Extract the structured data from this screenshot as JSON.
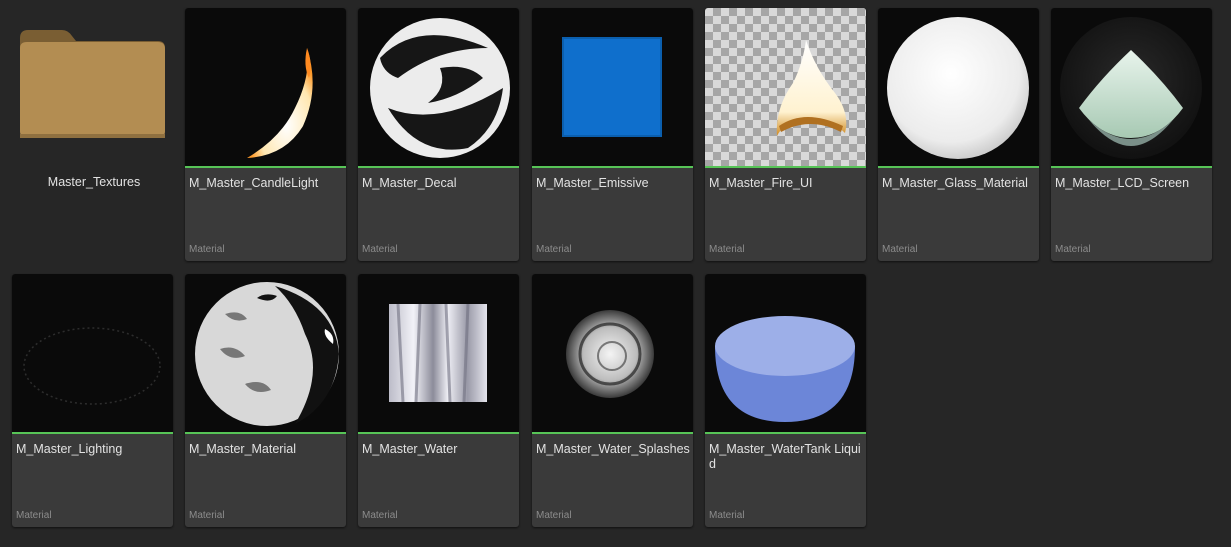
{
  "theme": {
    "background": "#262626",
    "tile_background": "#3a3a3a",
    "material_type_color": "#57c457"
  },
  "folder": {
    "name": "Master_Textures",
    "icon": "folder-icon",
    "color": "#b08a4e"
  },
  "assets": [
    {
      "name": "M_Master_CandleLight",
      "type": "Material"
    },
    {
      "name": "M_Master_Decal",
      "type": "Material"
    },
    {
      "name": "M_Master_Emissive",
      "type": "Material"
    },
    {
      "name": "M_Master_Fire_UI",
      "type": "Material"
    },
    {
      "name": "M_Master_Glass_Material",
      "type": "Material"
    },
    {
      "name": "M_Master_LCD_Screen",
      "type": "Material"
    },
    {
      "name": "M_Master_Lighting",
      "type": "Material"
    },
    {
      "name": "M_Master_Material",
      "type": "Material"
    },
    {
      "name": "M_Master_Water",
      "type": "Material"
    },
    {
      "name": "M_Master_Water_Splashes",
      "type": "Material"
    },
    {
      "name": "M_Master_WaterTank Liquid",
      "type": "Material"
    }
  ]
}
